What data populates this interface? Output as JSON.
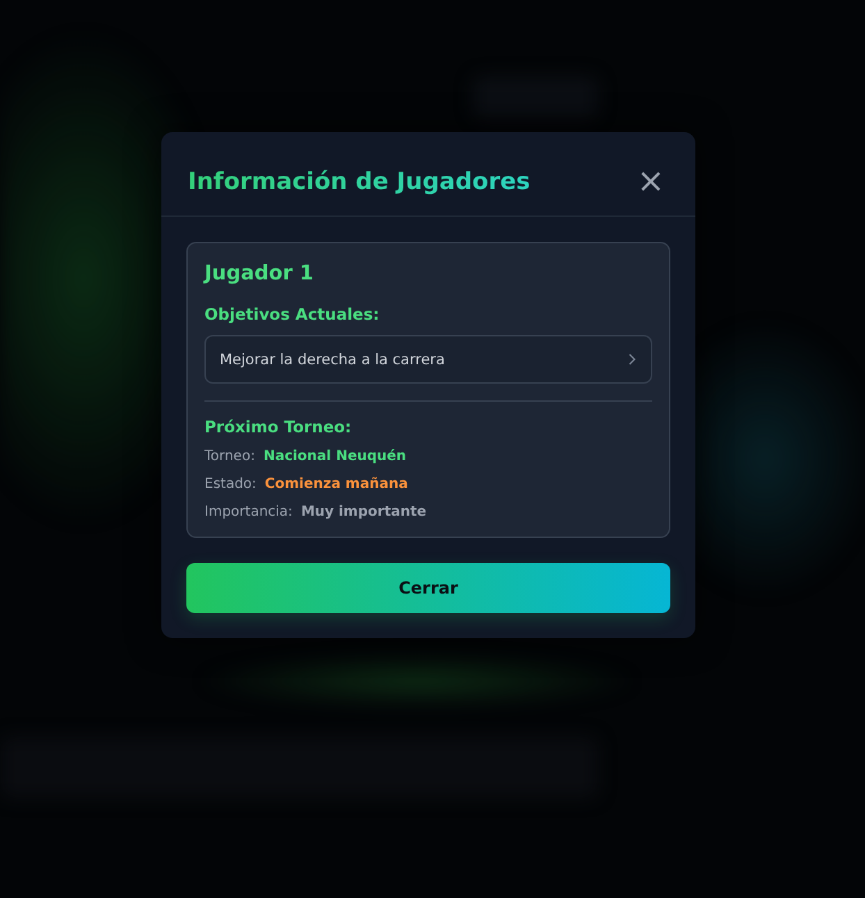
{
  "modal": {
    "title": "Información de Jugadores",
    "close_icon": "×",
    "player": {
      "name": "Jugador 1",
      "goals_heading": "Objetivos Actuales:",
      "goals": [
        {
          "text": "Mejorar la derecha a la carrera"
        }
      ],
      "tournament_heading": "Próximo Torneo:",
      "details": [
        {
          "label": "Torneo:",
          "value": "Nacional Neuquén",
          "color": "#4ade80"
        },
        {
          "label": "Estado:",
          "value": "Comienza mañana",
          "color": "#fb923c"
        },
        {
          "label": "Importancia:",
          "value": "Muy importante",
          "color": "#9ca3af"
        }
      ]
    },
    "button": "Cerrar"
  }
}
